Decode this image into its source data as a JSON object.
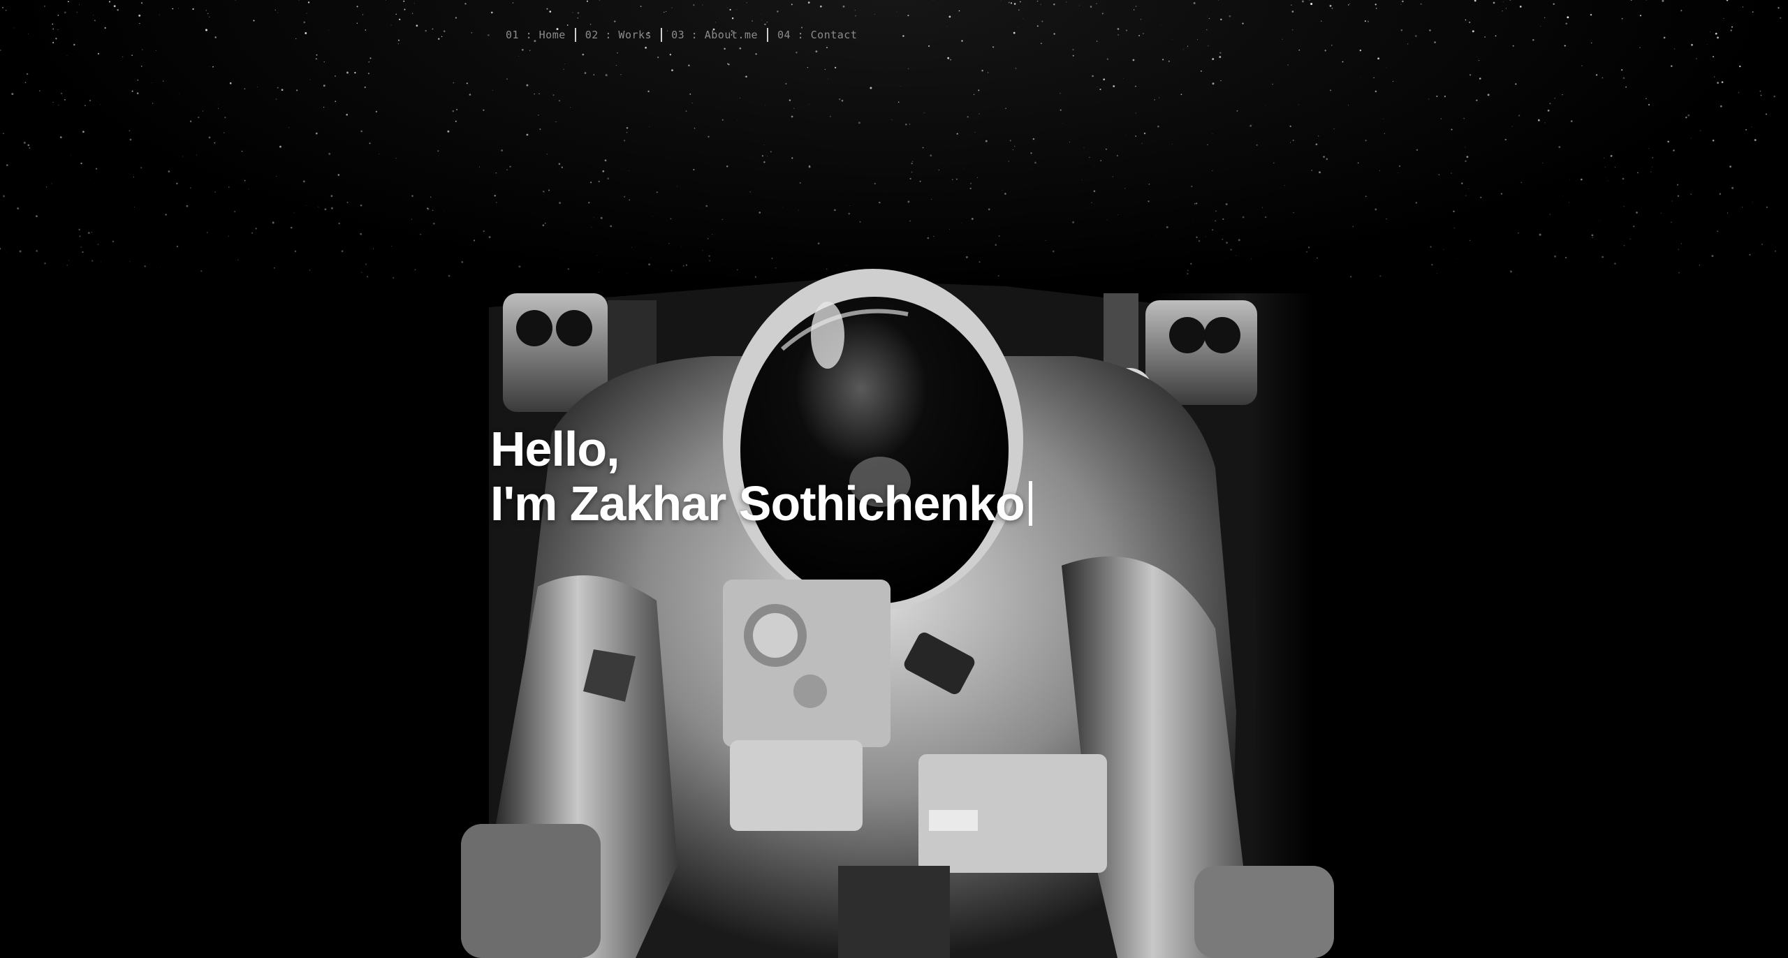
{
  "nav": {
    "items": [
      {
        "label": "01 : Home"
      },
      {
        "label": "02 : Works"
      },
      {
        "label": "03 : About.me"
      },
      {
        "label": "04 : Contact"
      }
    ]
  },
  "hero": {
    "greeting": "Hello,",
    "name_line": "I'm Zakhar Sothichenko"
  },
  "background": {
    "icon": "astronaut-photo",
    "stars_icon": "starfield"
  }
}
